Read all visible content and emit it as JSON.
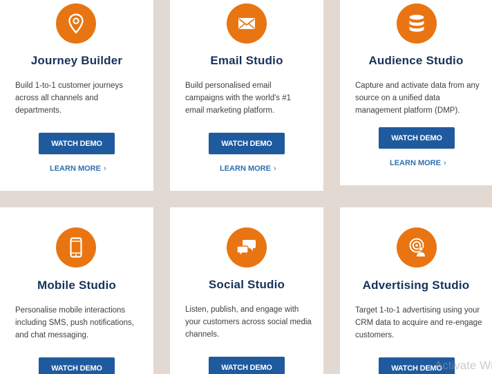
{
  "cards": [
    {
      "title": "Journey Builder",
      "desc": "Build 1-to-1 customer journeys\nacross all channels and\ndepartments.",
      "button": "WATCH DEMO",
      "link": "LEARN MORE",
      "icon": "map-pin-icon"
    },
    {
      "title": "Email Studio",
      "desc": "Build personalised email\ncampaigns with the world's #1\nemail marketing platform.",
      "button": "WATCH DEMO",
      "link": "LEARN MORE",
      "icon": "envelope-icon"
    },
    {
      "title": "Audience Studio",
      "desc": "Capture and activate data from any\nsource on a unified data\nmanagement platform (DMP).",
      "button": "WATCH DEMO",
      "link": "LEARN MORE",
      "icon": "database-icon"
    },
    {
      "title": "Mobile Studio",
      "desc": "Personalise mobile interactions\nincluding SMS, push notifications,\nand chat messaging.",
      "button": "WATCH DEMO",
      "icon": "phone-icon"
    },
    {
      "title": "Social Studio",
      "desc": "Listen, publish, and engage with\nyour customers across social media\nchannels.",
      "button": "WATCH DEMO",
      "icon": "chat-bubbles-icon"
    },
    {
      "title": "Advertising Studio",
      "desc": "Target 1-to-1 advertising using your\nCRM data to acquire and re-engage\ncustomers.",
      "button": "WATCH DEMO",
      "icon": "target-user-icon"
    }
  ],
  "watermark": "Activate Wi",
  "colors": {
    "accent": "#e87511",
    "button": "#1f5a9e",
    "title": "#16325c",
    "link": "#2e6fb0",
    "background": "#e2d9d2"
  }
}
